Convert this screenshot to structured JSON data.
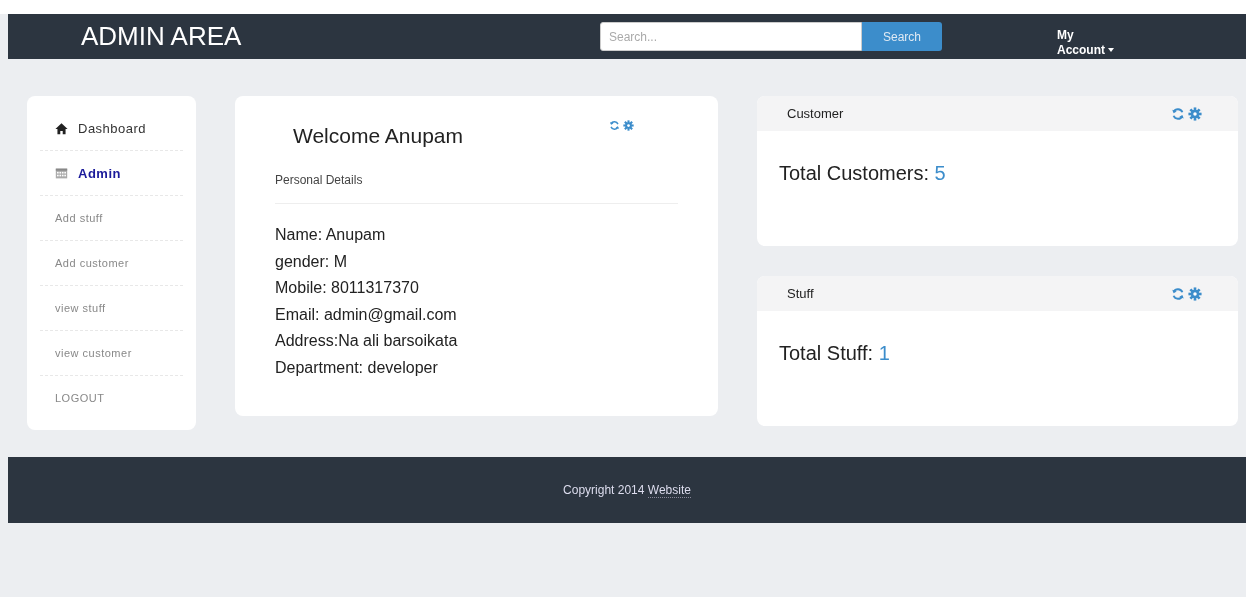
{
  "navbar": {
    "brand": "ADMIN AREA",
    "search": {
      "placeholder": "Search..."
    },
    "search_button": "Search",
    "account": "My Account"
  },
  "sidebar": {
    "items": [
      {
        "label": "Dashboard",
        "kind": "home",
        "selected": false
      },
      {
        "label": "Admin",
        "kind": "calendar",
        "selected": true
      },
      {
        "label": "Add stuff",
        "kind": "sub",
        "selected": false
      },
      {
        "label": "Add customer",
        "kind": "sub",
        "selected": false
      },
      {
        "label": "view stuff",
        "kind": "sub",
        "selected": false
      },
      {
        "label": "view customer",
        "kind": "sub",
        "selected": false
      },
      {
        "label": "LOGOUT",
        "kind": "sub",
        "selected": false
      }
    ]
  },
  "profile": {
    "title": "Welcome Anupam",
    "subtitle": "Personal Details",
    "details": [
      "Name: Anupam",
      "gender: M",
      "Mobile: 8011317370",
      "Email: admin@gmail.com",
      "Address:Na ali barsoikata",
      "Department: developer"
    ]
  },
  "panels": [
    {
      "heading": "Customer",
      "label": "Total Customers:",
      "value": "5"
    },
    {
      "heading": "Stuff",
      "label": "Total Stuff:",
      "value": "1"
    }
  ],
  "footer": {
    "text": "Copyright 2014",
    "link": "Website"
  }
}
